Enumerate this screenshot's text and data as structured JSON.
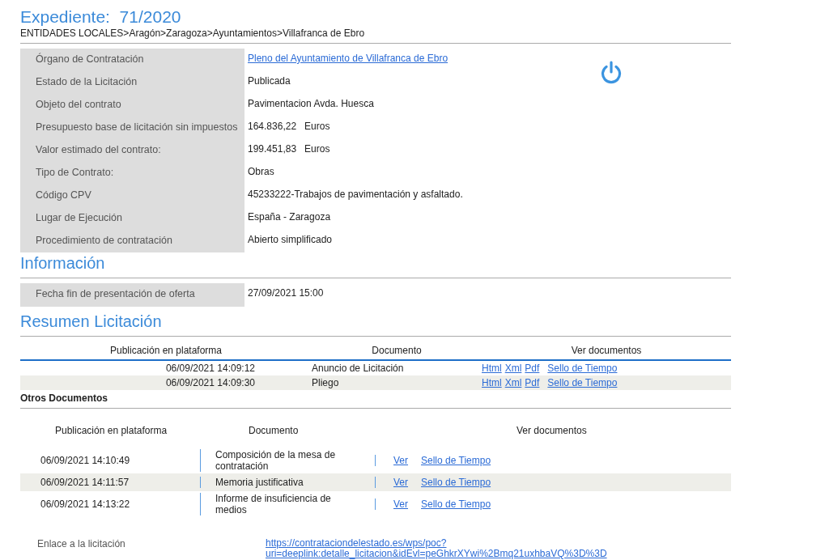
{
  "header": {
    "title": "Expediente:  71/2020",
    "breadcrumb": "ENTIDADES LOCALES>Aragón>Zaragoza>Ayuntamientos>Villafranca de Ebro"
  },
  "details": [
    {
      "label": "Órgano de Contratación",
      "value": "Pleno del Ayuntamiento de Villafranca de Ebro",
      "kind": "link"
    },
    {
      "label": "Estado de la Licitación",
      "value": "Publicada",
      "kind": "text"
    },
    {
      "label": "Objeto del contrato",
      "value": "Pavimentacion Avda. Huesca",
      "kind": "text"
    },
    {
      "label": "Presupuesto base de licitación sin impuestos",
      "value": "164.836,22   Euros",
      "kind": "text"
    },
    {
      "label": "Valor estimado del contrato:",
      "value": "199.451,83   Euros",
      "kind": "text"
    },
    {
      "label": "Tipo de Contrato:",
      "value": "Obras",
      "kind": "text"
    },
    {
      "label": "Código CPV",
      "value": "45233222-Trabajos de pavimentación y asfaltado.",
      "kind": "text"
    },
    {
      "label": "Lugar de Ejecución",
      "value": "España - Zaragoza",
      "kind": "text"
    },
    {
      "label": "Procedimiento de contratación",
      "value": "Abierto simplificado",
      "kind": "text"
    }
  ],
  "informacion": {
    "title": "Información",
    "rows": [
      {
        "label": "Fecha fin de presentación de oferta",
        "value": "27/09/2021 15:00"
      }
    ]
  },
  "resumen": {
    "title": "Resumen Licitación",
    "columns": [
      "Publicación en plataforma",
      "Documento",
      "Ver documentos"
    ],
    "rows": [
      {
        "date": "06/09/2021 14:09:12",
        "document": "Anuncio de Licitación",
        "links": [
          "Html",
          "Xml",
          "Pdf"
        ],
        "stamp": "Sello de Tiempo"
      },
      {
        "date": "06/09/2021 14:09:30",
        "document": "Pliego",
        "links": [
          "Html",
          "Xml",
          "Pdf"
        ],
        "stamp": "Sello de Tiempo"
      }
    ]
  },
  "otros": {
    "title": "Otros Documentos",
    "columns": [
      "Publicación en plataforma",
      "Documento",
      "Ver documentos"
    ],
    "rows": [
      {
        "date": "06/09/2021 14:10:49",
        "document": "Composición de la mesa de contratación",
        "view": "Ver",
        "stamp": "Sello de Tiempo"
      },
      {
        "date": "06/09/2021 14:11:57",
        "document": "Memoria justificativa",
        "view": "Ver",
        "stamp": "Sello de Tiempo"
      },
      {
        "date": "06/09/2021 14:13:22",
        "document": "Informe de insuficiencia de medios",
        "view": "Ver",
        "stamp": "Sello de Tiempo"
      }
    ]
  },
  "enlace": {
    "label": "Enlace a la licitación",
    "url_line_1": "https://contrataciondelestado.es/wps/poc?",
    "url_line_2": "uri=deeplink:detalle_licitacion&idEvl=peGhkrXYwi%2Bmq21uxhbaVQ%3D%3D"
  }
}
